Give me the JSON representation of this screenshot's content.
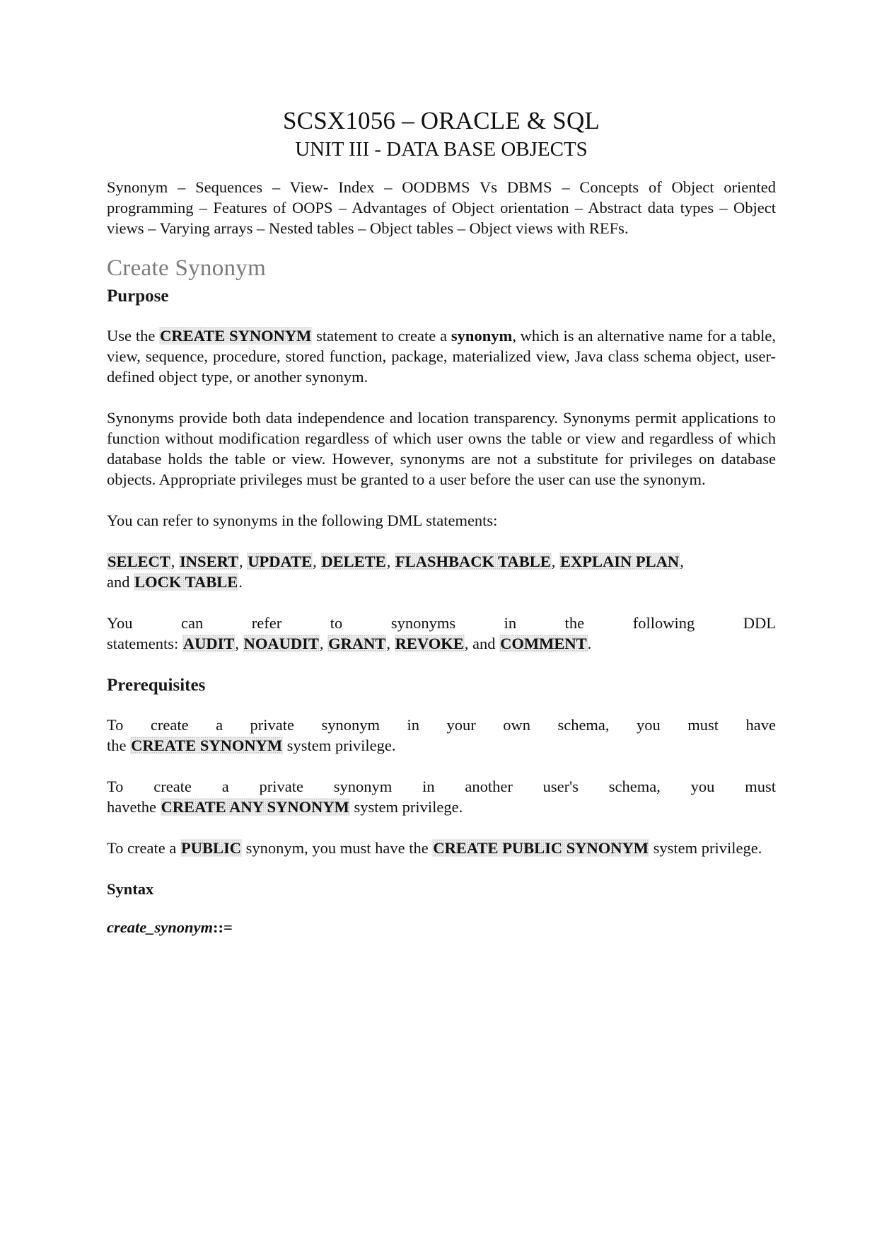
{
  "document": {
    "title": "SCSX1056 – ORACLE & SQL",
    "subtitle": "UNIT III - DATA BASE OBJECTS",
    "syllabus": "Synonym – Sequences – View- Index – OODBMS Vs DBMS – Concepts of Object oriented programming – Features of OOPS – Advantages of Object orientation – Abstract data types – Object views – Varying arrays – Nested tables – Object tables – Object views with REFs.",
    "section_heading": "Create Synonym",
    "purpose": {
      "heading": "Purpose",
      "p1": {
        "t1": "Use the ",
        "kw1": "CREATE SYNONYM",
        "t2": " statement to create a ",
        "bold1": "synonym",
        "t3": ", which is an alternative name for a table, view, sequence, procedure, stored function, package, materialized view, Java class schema object, user-defined object type, or another synonym."
      },
      "p2": "Synonyms provide both data independence and location transparency. Synonyms permit applications to function without modification regardless of which user owns the table or view and regardless of which database holds the table or view. However, synonyms are not a substitute for privileges on database objects. Appropriate privileges must be granted to a user before the user can use the synonym.",
      "p3": "You can refer to synonyms in the following DML statements:",
      "dml_keywords": [
        "SELECT",
        "INSERT",
        "UPDATE",
        "DELETE",
        "FLASHBACK TABLE",
        "EXPLAIN PLAN",
        "LOCK TABLE"
      ],
      "dml_and": "and ",
      "p5_line1": "You can refer to synonyms in the following DDL",
      "p5_prefix": "statements: ",
      "ddl_keywords": [
        "AUDIT",
        "NOAUDIT",
        "GRANT",
        "REVOKE",
        "COMMENT"
      ],
      "ddl_and": ", and "
    },
    "prerequisites": {
      "heading": "Prerequisites",
      "p1_line1": "To create a private synonym in your own schema, you must have",
      "p1_pre": "the ",
      "p1_kw": "CREATE SYNONYM",
      "p1_post": " system privilege.",
      "p2_line1": "To create a private synonym in another user's schema, you must",
      "p2_pre": "havethe ",
      "p2_kw": "CREATE ANY SYNONYM",
      "p2_post": " system privilege.",
      "p3_t1": "To create a ",
      "p3_kw1": "PUBLIC",
      "p3_t2": " synonym, you must have the ",
      "p3_kw2": "CREATE PUBLIC SYNONYM",
      "p3_t3": " system privilege."
    },
    "syntax": {
      "heading": "Syntax",
      "rule_name": "create_synonym",
      "rule_op": "::="
    }
  }
}
